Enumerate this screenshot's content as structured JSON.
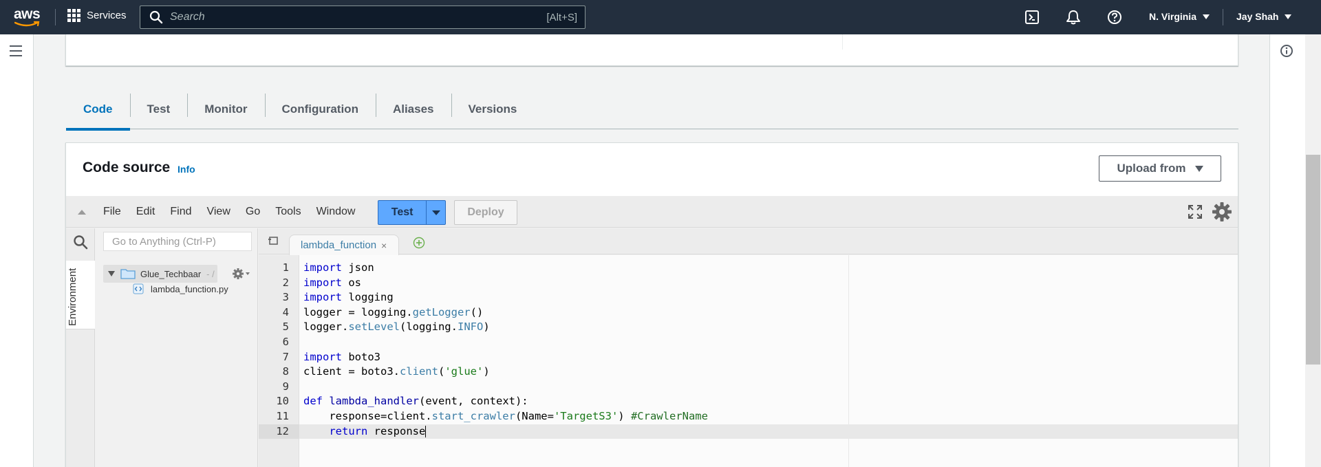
{
  "topnav": {
    "logo_text": "aws",
    "services_label": "Services",
    "search_placeholder": "Search",
    "search_shortcut": "[Alt+S]",
    "region_label": "N. Virginia",
    "user_label": "Jay Shah"
  },
  "tabs": [
    {
      "label": "Code",
      "active": true
    },
    {
      "label": "Test",
      "active": false
    },
    {
      "label": "Monitor",
      "active": false
    },
    {
      "label": "Configuration",
      "active": false
    },
    {
      "label": "Aliases",
      "active": false
    },
    {
      "label": "Versions",
      "active": false
    }
  ],
  "code_source": {
    "title": "Code source",
    "info_link": "Info",
    "upload_label": "Upload from"
  },
  "ide": {
    "menu": [
      "File",
      "Edit",
      "Find",
      "View",
      "Go",
      "Tools",
      "Window"
    ],
    "test_label": "Test",
    "deploy_label": "Deploy",
    "environment_tab": "Environment",
    "goto_placeholder": "Go to Anything (Ctrl-P)",
    "folder_name": "Glue_Techbaar",
    "folder_suffix": "- /",
    "file_name": "lambda_function.py",
    "editor_tab": "lambda_function",
    "editor_tab_close": "×"
  },
  "code_lines": [
    {
      "n": "1",
      "text": "import json"
    },
    {
      "n": "2",
      "text": "import os"
    },
    {
      "n": "3",
      "text": "import logging"
    },
    {
      "n": "4",
      "text": "logger = logging.getLogger()"
    },
    {
      "n": "5",
      "text": "logger.setLevel(logging.INFO)"
    },
    {
      "n": "6",
      "text": ""
    },
    {
      "n": "7",
      "text": "import boto3"
    },
    {
      "n": "8",
      "text": "client = boto3.client('glue')"
    },
    {
      "n": "9",
      "text": ""
    },
    {
      "n": "10",
      "text": "def lambda_handler(event, context):"
    },
    {
      "n": "11",
      "text": "    response=client.start_crawler(Name='TargetS3') #CrawlerName"
    },
    {
      "n": "12",
      "text": "    return response"
    }
  ],
  "colors": {
    "nav_bg": "#232f3e",
    "accent": "#0073bb",
    "test_button": "#5ea8ff"
  }
}
